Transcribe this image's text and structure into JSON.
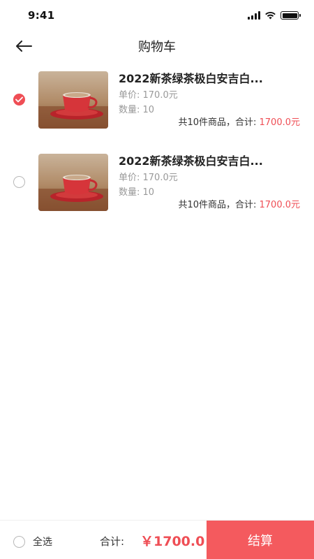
{
  "status_bar": {
    "time": "9:41"
  },
  "nav": {
    "title": "购物车"
  },
  "items": [
    {
      "title": "2022新茶绿茶极白安吉白...",
      "unit_price": "单价: 170.0元",
      "quantity": "数量: 10",
      "summary_prefix": "共10件商品，合计: ",
      "summary_amount": "1700.0元",
      "selected": true
    },
    {
      "title": "2022新茶绿茶极白安吉白...",
      "unit_price": "单价: 170.0元",
      "quantity": "数量: 10",
      "summary_prefix": "共10件商品，合计: ",
      "summary_amount": "1700.0元",
      "selected": false
    }
  ],
  "bottom": {
    "select_all": "全选",
    "total_label": "合计:",
    "total_value": "￥1700.0",
    "checkout": "结算"
  },
  "colors": {
    "accent": "#ef4e55",
    "checkout_bg": "#f45a5e"
  }
}
